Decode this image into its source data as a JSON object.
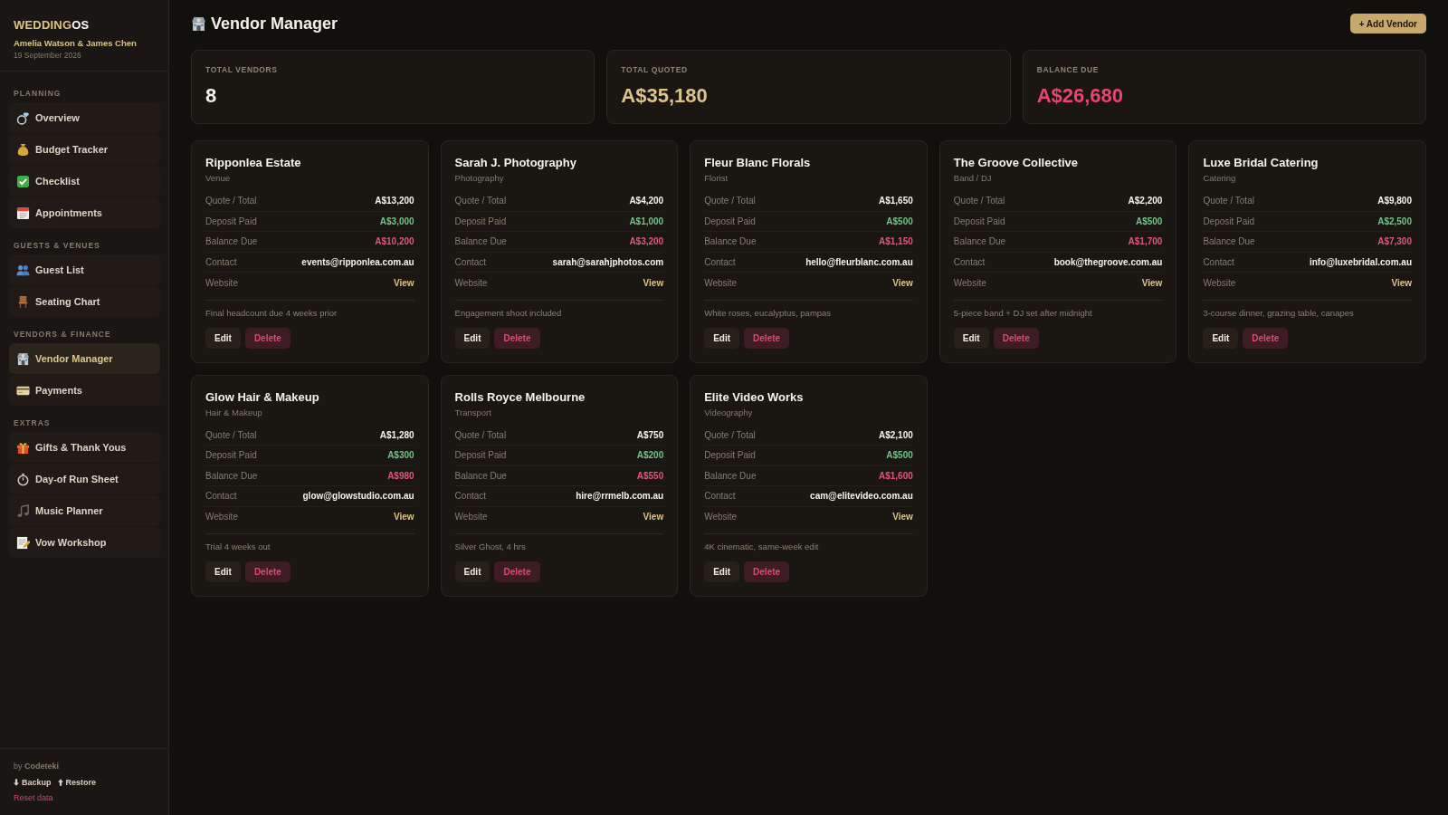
{
  "sidebar": {
    "logo": {
      "text": "WEDDING",
      "accent": "OS"
    },
    "couple": "Amelia Watson & James Chen",
    "date": "19 September 2026",
    "sections": [
      {
        "title": "PLANNING",
        "items": [
          {
            "label": "Overview",
            "selected": false
          },
          {
            "label": "Budget Tracker",
            "selected": false
          },
          {
            "label": "Checklist",
            "selected": false
          },
          {
            "label": "Appointments",
            "selected": false
          }
        ]
      },
      {
        "title": "GUESTS & VENUES",
        "items": [
          {
            "label": "Guest List",
            "selected": false
          },
          {
            "label": "Seating Chart",
            "selected": false
          }
        ]
      },
      {
        "title": "VENDORS & FINANCE",
        "items": [
          {
            "label": "Vendor Manager",
            "selected": true
          },
          {
            "label": "Payments",
            "selected": false
          }
        ]
      },
      {
        "title": "EXTRAS",
        "items": [
          {
            "label": "Gifts & Thank Yous",
            "selected": false
          },
          {
            "label": "Day-of Run Sheet",
            "selected": false
          },
          {
            "label": "Music Planner",
            "selected": false
          },
          {
            "label": "Vow Workshop",
            "selected": false
          }
        ]
      }
    ],
    "footer": {
      "credit": "by **Codeteki**",
      "links": [
        {
          "label": "Backup"
        },
        {
          "label": "Restore"
        }
      ],
      "reset": "Reset data"
    }
  },
  "header": {
    "title": "Vendor Manager",
    "add_button": "+ Add Vendor"
  },
  "stats": [
    {
      "label": "TOTAL VENDORS",
      "value": "8",
      "kind": "count"
    },
    {
      "label": "TOTAL QUOTED",
      "value": "A$35,180",
      "kind": "quoted"
    },
    {
      "label": "BALANCE DUE",
      "value": "A$26,680",
      "kind": "due"
    }
  ],
  "vendors": [
    {
      "name": "Ripponlea Estate",
      "category": "Venue",
      "fields": [
        {
          "label": "Quote / Total",
          "value": "A$13,200",
          "kind": "amount"
        },
        {
          "label": "Deposit Paid",
          "value": "A$3,000",
          "kind": "paid"
        },
        {
          "label": "Balance Due",
          "value": "A$10,200",
          "kind": "due"
        },
        {
          "label": "Contact",
          "value": "events@ripponlea.com.au",
          "kind": "contact"
        },
        {
          "label": "Website",
          "value": "View",
          "kind": "link"
        }
      ],
      "note": "Final headcount due 4 weeks prior",
      "actions": [
        {
          "label": "Edit",
          "kind": "edit"
        },
        {
          "label": "Delete",
          "kind": "delete"
        }
      ]
    },
    {
      "name": "Sarah J. Photography",
      "category": "Photography",
      "fields": [
        {
          "label": "Quote / Total",
          "value": "A$4,200",
          "kind": "amount"
        },
        {
          "label": "Deposit Paid",
          "value": "A$1,000",
          "kind": "paid"
        },
        {
          "label": "Balance Due",
          "value": "A$3,200",
          "kind": "due"
        },
        {
          "label": "Contact",
          "value": "sarah@sarahjphotos.com",
          "kind": "contact"
        },
        {
          "label": "Website",
          "value": "View",
          "kind": "link"
        }
      ],
      "note": "Engagement shoot included",
      "actions": [
        {
          "label": "Edit",
          "kind": "edit"
        },
        {
          "label": "Delete",
          "kind": "delete"
        }
      ]
    },
    {
      "name": "Fleur Blanc Florals",
      "category": "Florist",
      "fields": [
        {
          "label": "Quote / Total",
          "value": "A$1,650",
          "kind": "amount"
        },
        {
          "label": "Deposit Paid",
          "value": "A$500",
          "kind": "paid"
        },
        {
          "label": "Balance Due",
          "value": "A$1,150",
          "kind": "due"
        },
        {
          "label": "Contact",
          "value": "hello@fleurblanc.com.au",
          "kind": "contact"
        },
        {
          "label": "Website",
          "value": "View",
          "kind": "link"
        }
      ],
      "note": "White roses, eucalyptus, pampas",
      "actions": [
        {
          "label": "Edit",
          "kind": "edit"
        },
        {
          "label": "Delete",
          "kind": "delete"
        }
      ]
    },
    {
      "name": "The Groove Collective",
      "category": "Band / DJ",
      "fields": [
        {
          "label": "Quote / Total",
          "value": "A$2,200",
          "kind": "amount"
        },
        {
          "label": "Deposit Paid",
          "value": "A$500",
          "kind": "paid"
        },
        {
          "label": "Balance Due",
          "value": "A$1,700",
          "kind": "due"
        },
        {
          "label": "Contact",
          "value": "book@thegroove.com.au",
          "kind": "contact"
        },
        {
          "label": "Website",
          "value": "View",
          "kind": "link"
        }
      ],
      "note": "5-piece band + DJ set after midnight",
      "actions": [
        {
          "label": "Edit",
          "kind": "edit"
        },
        {
          "label": "Delete",
          "kind": "delete"
        }
      ]
    },
    {
      "name": "Luxe Bridal Catering",
      "category": "Catering",
      "fields": [
        {
          "label": "Quote / Total",
          "value": "A$9,800",
          "kind": "amount"
        },
        {
          "label": "Deposit Paid",
          "value": "A$2,500",
          "kind": "paid"
        },
        {
          "label": "Balance Due",
          "value": "A$7,300",
          "kind": "due"
        },
        {
          "label": "Contact",
          "value": "info@luxebridal.com.au",
          "kind": "contact"
        },
        {
          "label": "Website",
          "value": "View",
          "kind": "link"
        }
      ],
      "note": "3-course dinner, grazing table, canapes",
      "actions": [
        {
          "label": "Edit",
          "kind": "edit"
        },
        {
          "label": "Delete",
          "kind": "delete"
        }
      ]
    },
    {
      "name": "Glow Hair & Makeup",
      "category": "Hair & Makeup",
      "fields": [
        {
          "label": "Quote / Total",
          "value": "A$1,280",
          "kind": "amount"
        },
        {
          "label": "Deposit Paid",
          "value": "A$300",
          "kind": "paid"
        },
        {
          "label": "Balance Due",
          "value": "A$980",
          "kind": "due"
        },
        {
          "label": "Contact",
          "value": "glow@glowstudio.com.au",
          "kind": "contact"
        },
        {
          "label": "Website",
          "value": "View",
          "kind": "link"
        }
      ],
      "note": "Trial 4 weeks out",
      "actions": [
        {
          "label": "Edit",
          "kind": "edit"
        },
        {
          "label": "Delete",
          "kind": "delete"
        }
      ]
    },
    {
      "name": "Rolls Royce Melbourne",
      "category": "Transport",
      "fields": [
        {
          "label": "Quote / Total",
          "value": "A$750",
          "kind": "amount"
        },
        {
          "label": "Deposit Paid",
          "value": "A$200",
          "kind": "paid"
        },
        {
          "label": "Balance Due",
          "value": "A$550",
          "kind": "due"
        },
        {
          "label": "Contact",
          "value": "hire@rrmelb.com.au",
          "kind": "contact"
        },
        {
          "label": "Website",
          "value": "View",
          "kind": "link"
        }
      ],
      "note": "Silver Ghost, 4 hrs",
      "actions": [
        {
          "label": "Edit",
          "kind": "edit"
        },
        {
          "label": "Delete",
          "kind": "delete"
        }
      ]
    },
    {
      "name": "Elite Video Works",
      "category": "Videography",
      "fields": [
        {
          "label": "Quote / Total",
          "value": "A$2,100",
          "kind": "amount"
        },
        {
          "label": "Deposit Paid",
          "value": "A$500",
          "kind": "paid"
        },
        {
          "label": "Balance Due",
          "value": "A$1,600",
          "kind": "due"
        },
        {
          "label": "Contact",
          "value": "cam@elitevideo.com.au",
          "kind": "contact"
        },
        {
          "label": "Website",
          "value": "View",
          "kind": "link"
        }
      ],
      "note": "4K cinematic, same-week edit",
      "actions": [
        {
          "label": "Edit",
          "kind": "edit"
        },
        {
          "label": "Delete",
          "kind": "delete"
        }
      ]
    }
  ]
}
